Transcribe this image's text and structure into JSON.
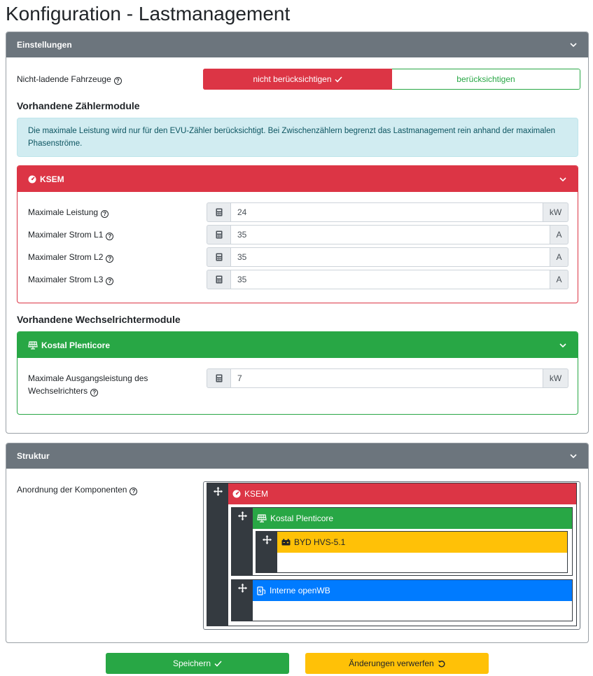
{
  "page": {
    "title": "Konfiguration - Lastmanagement"
  },
  "settings": {
    "header": "Einstellungen",
    "non_charging": {
      "label": "Nicht-ladende Fahrzeuge",
      "option_on": "nicht berücksichtigen",
      "option_off": "berücksichtigen",
      "selected": "nicht berücksichtigen"
    },
    "meters_heading": "Vorhandene Zählermodule",
    "alert": "Die maximale Leistung wird nur für den EVU-Zähler berücksichtigt. Bei Zwischenzählern begrenzt das Lastmanagement rein anhand der maximalen Phasenströme.",
    "ksem": {
      "title": "KSEM",
      "fields": [
        {
          "label": "Maximale Leistung",
          "value": "24",
          "unit": "kW"
        },
        {
          "label": "Maximaler Strom L1",
          "value": "35",
          "unit": "A"
        },
        {
          "label": "Maximaler Strom L2",
          "value": "35",
          "unit": "A"
        },
        {
          "label": "Maximaler Strom L3",
          "value": "35",
          "unit": "A"
        }
      ]
    },
    "inverters_heading": "Vorhandene Wechselrichtermodule",
    "plenticore": {
      "title": "Kostal Plenticore",
      "field_label_1": "Maximale Ausgangsleistung des",
      "field_label_2": "Wechselrichters",
      "value": "7",
      "unit": "kW"
    }
  },
  "structure": {
    "header": "Struktur",
    "label": "Anordnung der Komponenten",
    "nodes": {
      "ksem": "KSEM",
      "plenticore": "Kostal Plenticore",
      "battery": "BYD HVS-5.1",
      "openwb": "Interne openWB"
    },
    "colors": {
      "red": "#dc3545",
      "green": "#28a745",
      "yellow": "#ffc107",
      "blue": "#007bff",
      "dark": "#343a40"
    }
  },
  "actions": {
    "save": "Speichern",
    "discard": "Änderungen verwerfen"
  }
}
